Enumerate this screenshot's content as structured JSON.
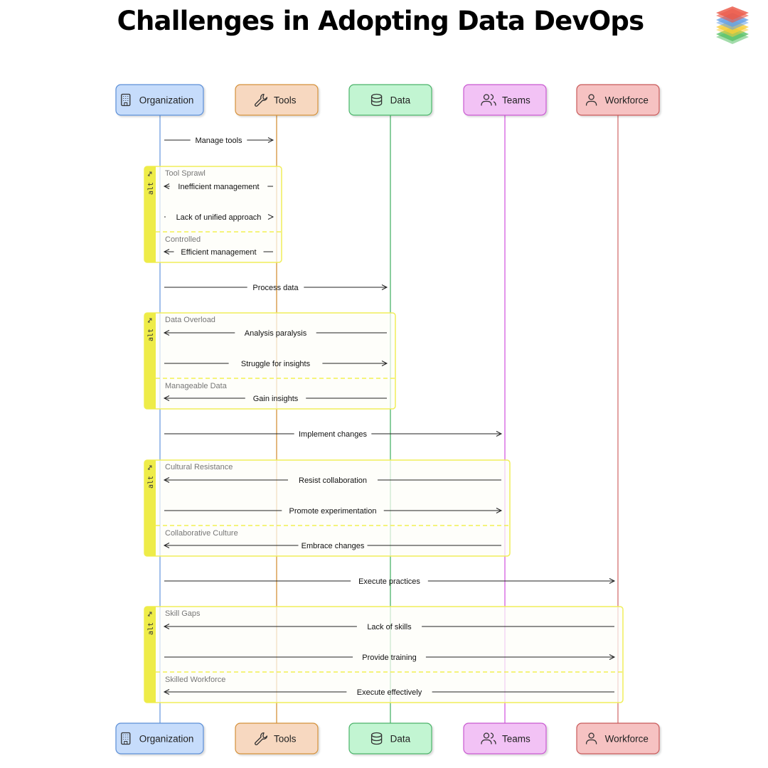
{
  "title": "Challenges in Adopting Data DevOps",
  "logo": {
    "icon": "stacked-layers-logo-icon",
    "colors": [
      "#e8412e",
      "#4a90e2",
      "#f5c518",
      "#3ab54a"
    ]
  },
  "actors": [
    {
      "id": "org",
      "label": "Organization",
      "icon": "building-icon",
      "fill": "#c6dcfb",
      "stroke": "#5b8ed6",
      "line": "#6f9ee0"
    },
    {
      "id": "tools",
      "label": "Tools",
      "icon": "wrench-icon",
      "fill": "#f7d8c0",
      "stroke": "#d4913a",
      "line": "#d4913a"
    },
    {
      "id": "data",
      "label": "Data",
      "icon": "database-icon",
      "fill": "#c2f5d2",
      "stroke": "#4cb36a",
      "line": "#4cb36a"
    },
    {
      "id": "teams",
      "label": "Teams",
      "icon": "users-icon",
      "fill": "#f2c2f5",
      "stroke": "#c85ad0",
      "line": "#d45ee0"
    },
    {
      "id": "workforce",
      "label": "Workforce",
      "icon": "user-icon",
      "fill": "#f6c2c2",
      "stroke": "#c85a5a",
      "line": "#d47070"
    }
  ],
  "sequence": [
    {
      "type": "message",
      "from": "org",
      "to": "tools",
      "label": "Manage tools"
    },
    {
      "type": "alt",
      "tag": "alt",
      "span_to": "tools",
      "sections": [
        {
          "label": "Tool Sprawl",
          "messages": [
            {
              "from": "tools",
              "to": "org",
              "label": "Inefficient management"
            },
            {
              "from": "org",
              "to": "tools",
              "label": "Lack of unified approach"
            }
          ]
        },
        {
          "label": "Controlled",
          "messages": [
            {
              "from": "tools",
              "to": "org",
              "label": "Efficient management"
            }
          ]
        }
      ]
    },
    {
      "type": "message",
      "from": "org",
      "to": "data",
      "label": "Process data"
    },
    {
      "type": "alt",
      "tag": "alt",
      "span_to": "data",
      "sections": [
        {
          "label": "Data Overload",
          "messages": [
            {
              "from": "data",
              "to": "org",
              "label": "Analysis paralysis"
            },
            {
              "from": "org",
              "to": "data",
              "label": "Struggle for insights"
            }
          ]
        },
        {
          "label": "Manageable Data",
          "messages": [
            {
              "from": "data",
              "to": "org",
              "label": "Gain insights"
            }
          ]
        }
      ]
    },
    {
      "type": "message",
      "from": "org",
      "to": "teams",
      "label": "Implement changes"
    },
    {
      "type": "alt",
      "tag": "alt",
      "span_to": "teams",
      "sections": [
        {
          "label": "Cultural Resistance",
          "messages": [
            {
              "from": "teams",
              "to": "org",
              "label": "Resist collaboration"
            },
            {
              "from": "org",
              "to": "teams",
              "label": "Promote experimentation"
            }
          ]
        },
        {
          "label": "Collaborative Culture",
          "messages": [
            {
              "from": "teams",
              "to": "org",
              "label": "Embrace changes"
            }
          ]
        }
      ]
    },
    {
      "type": "message",
      "from": "org",
      "to": "workforce",
      "label": "Execute practices"
    },
    {
      "type": "alt",
      "tag": "alt",
      "span_to": "workforce",
      "sections": [
        {
          "label": "Skill Gaps",
          "messages": [
            {
              "from": "workforce",
              "to": "org",
              "label": "Lack of skills"
            },
            {
              "from": "org",
              "to": "workforce",
              "label": "Provide training"
            }
          ]
        },
        {
          "label": "Skilled Workforce",
          "messages": [
            {
              "from": "workforce",
              "to": "org",
              "label": "Execute effectively"
            }
          ]
        }
      ]
    }
  ],
  "frame_colors": {
    "border": "#f0ee5a",
    "tab": "#eeec48",
    "fill": "#fdfdf8",
    "divider": "#f0ee30"
  }
}
